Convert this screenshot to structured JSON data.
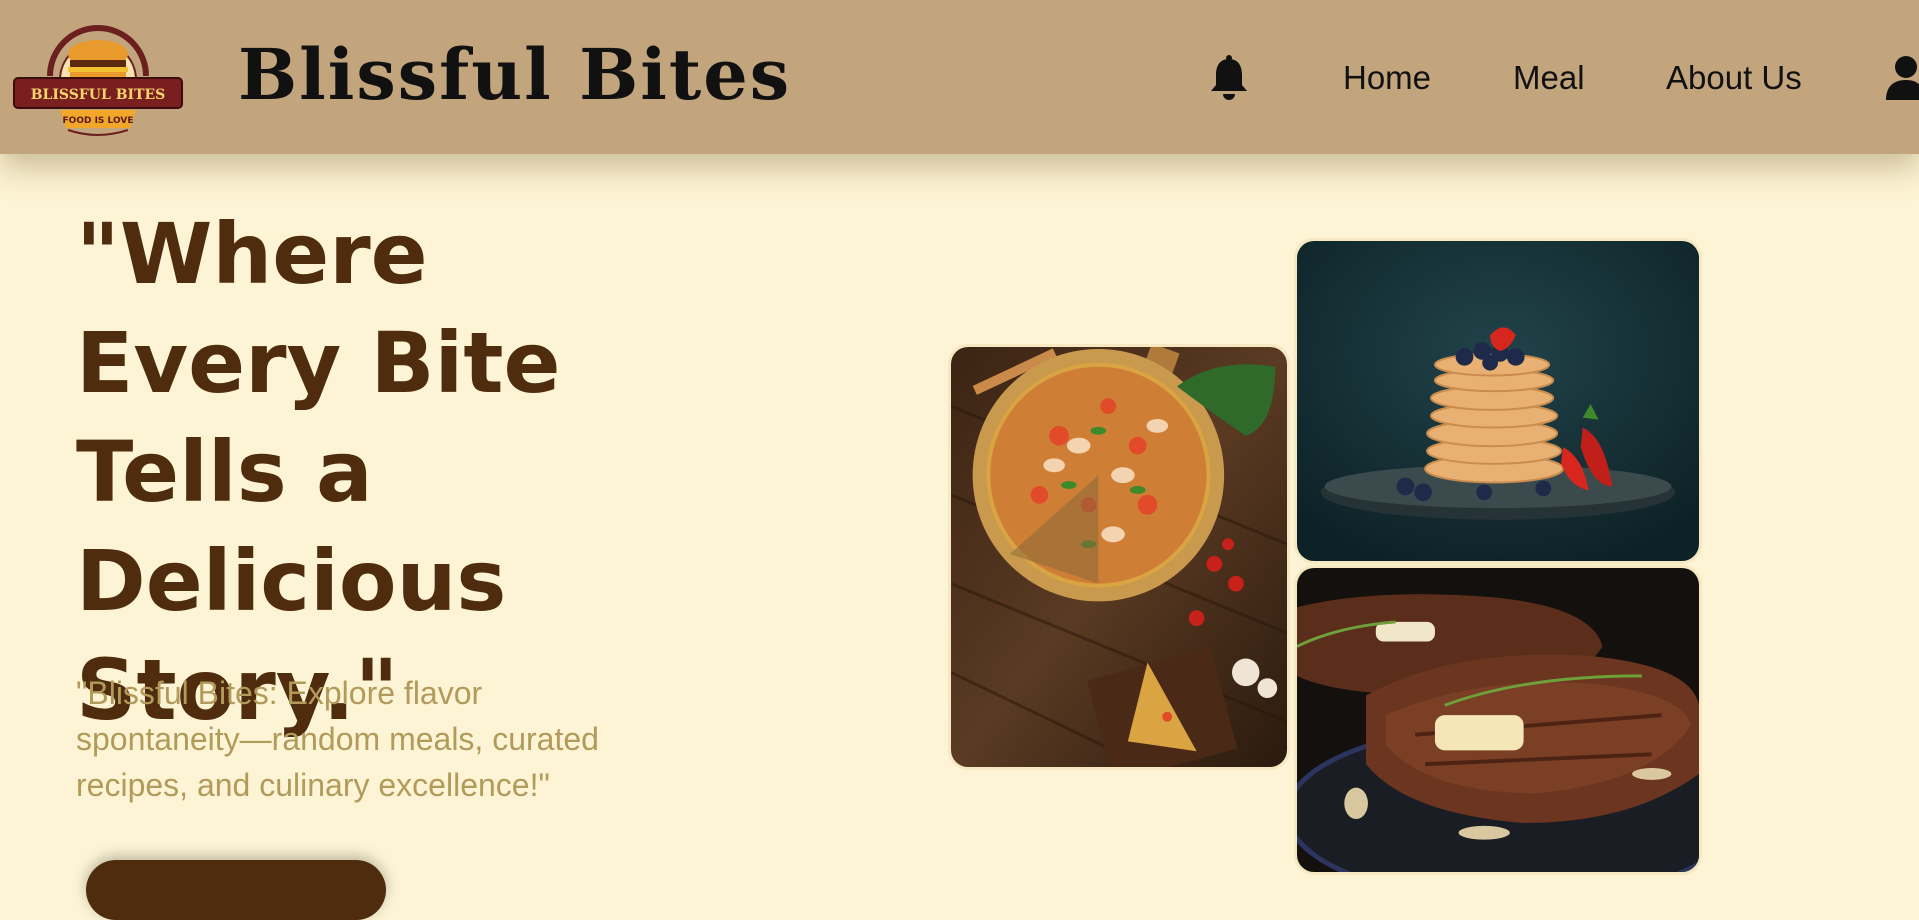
{
  "header": {
    "logo": {
      "name": "BLISSFUL BITES",
      "tagline": "FOOD IS LOVE"
    },
    "brand_title": "Blissful Bites",
    "nav": [
      {
        "label": "Home"
      },
      {
        "label": "Meal"
      },
      {
        "label": "About Us"
      }
    ],
    "icons": {
      "notifications": "bell-icon",
      "account": "user-icon"
    }
  },
  "hero": {
    "headline": "\"Where Every Bite Tells a Delicious Story.\"",
    "subheadline": "\"Blissful Bites: Explore flavor spontaneity—random meals, curated recipes, and culinary excellence!\""
  },
  "gallery": {
    "images": [
      {
        "subject": "pizza"
      },
      {
        "subject": "pancakes"
      },
      {
        "subject": "steak"
      }
    ]
  },
  "colors": {
    "header_bg": "#c2a57d",
    "page_bg": "#fdf4d5",
    "headline": "#4e2c0d",
    "subheadline": "#b29b5a"
  }
}
